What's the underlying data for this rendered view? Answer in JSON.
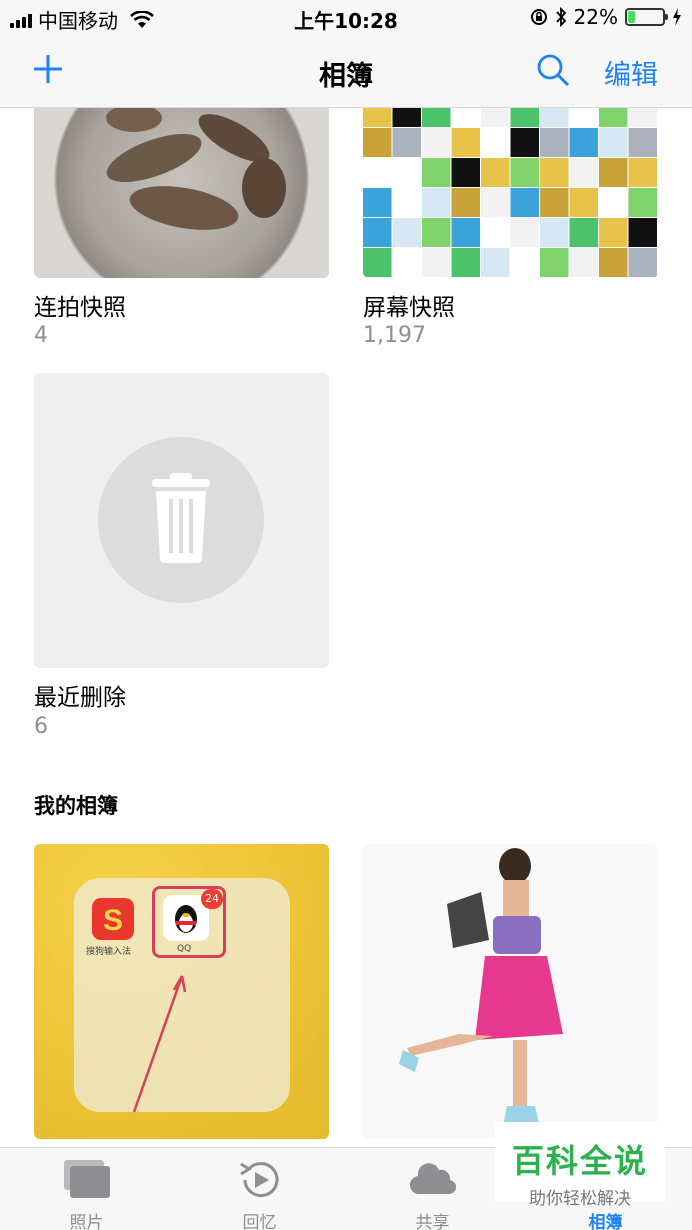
{
  "status_bar": {
    "carrier": "中国移动",
    "time": "上午10:28",
    "battery_percent": "22%",
    "battery_level": 0.22
  },
  "nav": {
    "title": "相簿",
    "edit_label": "编辑"
  },
  "albums": [
    {
      "name": "连拍快照",
      "count": "4"
    },
    {
      "name": "屏幕快照",
      "count": "1,197"
    },
    {
      "name": "最近删除",
      "count": "6"
    }
  ],
  "my_albums": {
    "title": "我的相簿",
    "app_sogou_label": "搜狗输入法",
    "app_qq_label": "QQ",
    "app_qq_badge": "24"
  },
  "tabs": [
    {
      "label": "照片",
      "icon": "photos-icon"
    },
    {
      "label": "回忆",
      "icon": "memories-icon"
    },
    {
      "label": "共享",
      "icon": "shared-cloud-icon"
    },
    {
      "label": "相簿",
      "icon": "albums-icon"
    }
  ],
  "watermark": {
    "title": "百科全说",
    "subtitle": "助你轻松解决"
  },
  "colors": {
    "accent": "#1d82f5",
    "battery_fill": "#4cd964",
    "secondary_text": "#8e8e93"
  }
}
